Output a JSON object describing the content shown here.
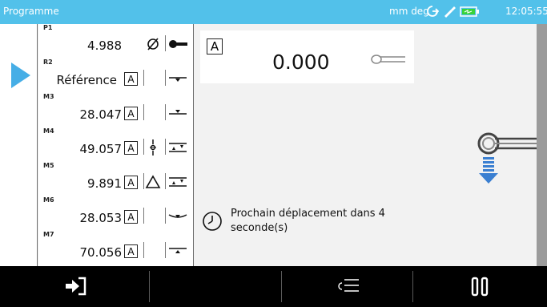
{
  "titlebar": {
    "title": "Programme",
    "units": "mm deg",
    "time": "12:05:55",
    "icons": [
      "sync-icon",
      "probe-pen-icon",
      "battery-icon"
    ]
  },
  "program_list": [
    {
      "tag": "P1",
      "value": "4.988",
      "box": "",
      "symbol": "diameter-icon",
      "feature": "probe-icon"
    },
    {
      "tag": "R2",
      "value": "Référence",
      "box": "A",
      "symbol": "",
      "feature": "reference-edge-icon"
    },
    {
      "tag": "M3",
      "value": "28.047",
      "box": "A",
      "symbol": "",
      "feature": "edge-down-icon"
    },
    {
      "tag": "M4",
      "value": "49.057",
      "box": "A",
      "symbol": "center-point-icon",
      "feature": "double-edge-icon"
    },
    {
      "tag": "M5",
      "value": "9.891",
      "box": "A",
      "symbol": "triangle-icon",
      "feature": "double-edge-icon"
    },
    {
      "tag": "M6",
      "value": "28.053",
      "box": "A",
      "symbol": "",
      "feature": "curve-down-icon"
    },
    {
      "tag": "M7",
      "value": "70.056",
      "box": "A",
      "symbol": "",
      "feature": "edge-up-icon"
    }
  ],
  "readout": {
    "ref_box": "A",
    "value": "0.000"
  },
  "message": {
    "line1": "Prochain déplacement dans 4",
    "line2": "seconde(s)"
  },
  "bottombar": {
    "buttons": [
      "exit-icon",
      "blank",
      "list-icon",
      "pause-icon"
    ]
  }
}
